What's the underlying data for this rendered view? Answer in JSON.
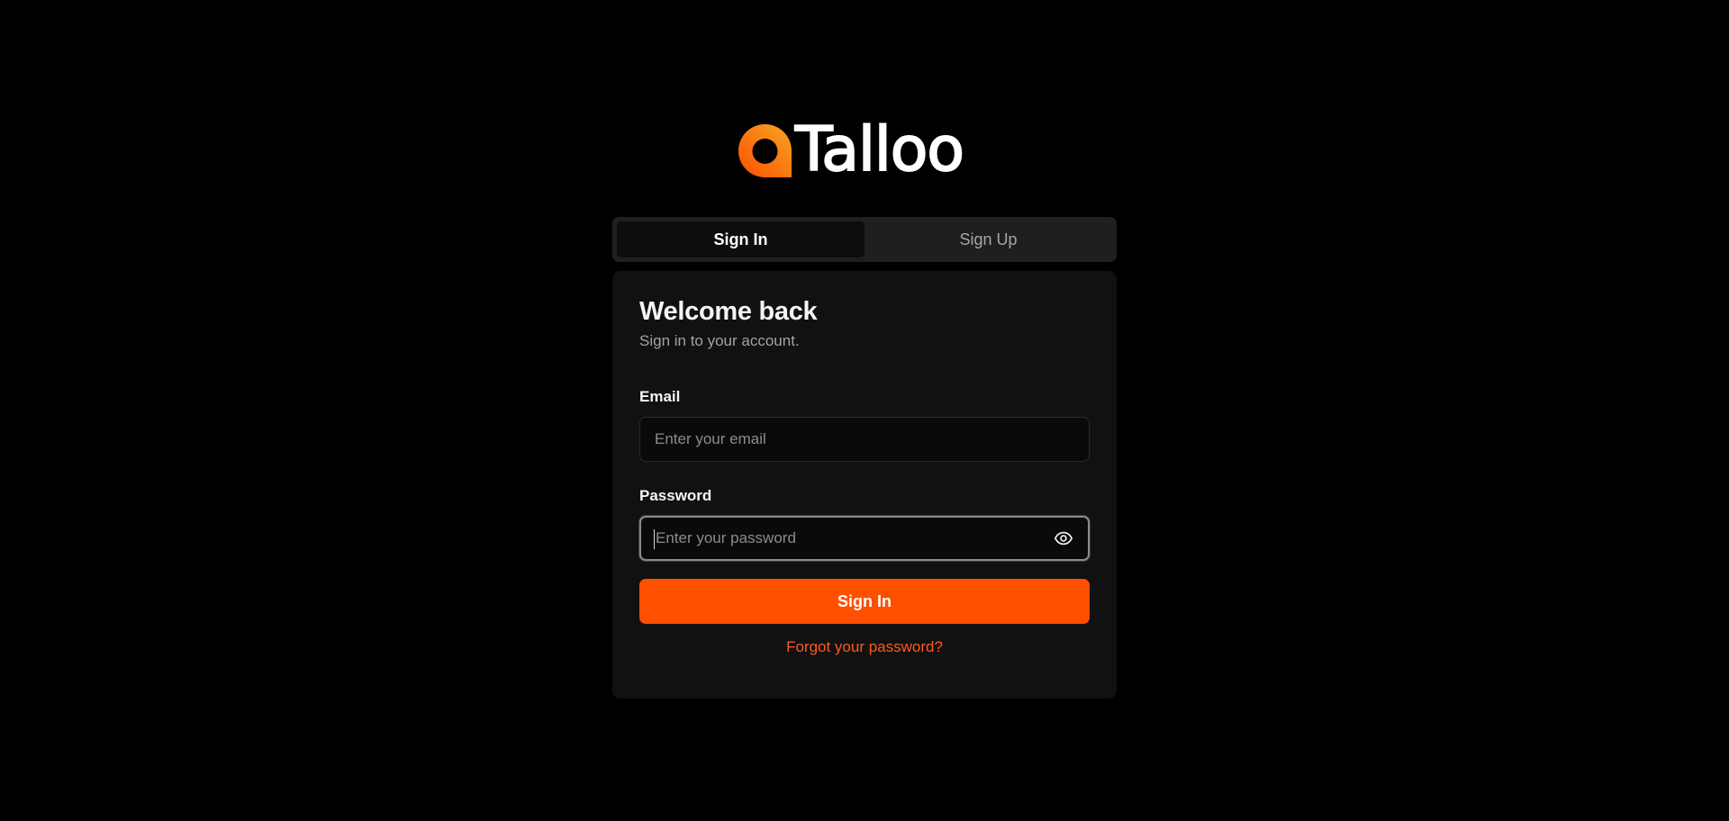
{
  "brand": {
    "name": "Talloo",
    "logo_icon": "talloo-logo-mark",
    "accent_color": "#ff4f00"
  },
  "tabs": [
    {
      "label": "Sign In",
      "active": true
    },
    {
      "label": "Sign Up",
      "active": false
    }
  ],
  "form": {
    "title": "Welcome back",
    "subtitle": "Sign in to your account.",
    "email": {
      "label": "Email",
      "placeholder": "Enter your email",
      "value": ""
    },
    "password": {
      "label": "Password",
      "placeholder": "Enter your password",
      "value": "",
      "toggle_icon": "eye-icon",
      "focused": true
    },
    "submit_label": "Sign In",
    "forgot_label": "Forgot your password?"
  }
}
